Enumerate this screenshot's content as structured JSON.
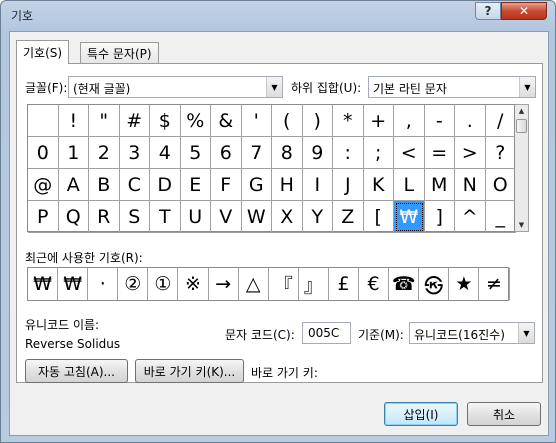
{
  "window": {
    "title": "기호",
    "help": "?",
    "close": "✕"
  },
  "tabs": [
    {
      "label": "기호(S)",
      "active": true
    },
    {
      "label": "특수 문자(P)",
      "active": false
    }
  ],
  "font": {
    "label": "글꼴(F):",
    "value": "(현재 글꼴)"
  },
  "subset": {
    "label": "하위 집합(U):",
    "value": "기본 라틴 문자"
  },
  "grid": {
    "rows": [
      [
        "",
        "!",
        "\"",
        "#",
        "$",
        "%",
        "&",
        "'",
        "(",
        ")",
        "*",
        "+",
        ",",
        "-",
        ".",
        "/"
      ],
      [
        "0",
        "1",
        "2",
        "3",
        "4",
        "5",
        "6",
        "7",
        "8",
        "9",
        ":",
        ";",
        "<",
        "=",
        ">",
        "?"
      ],
      [
        "@",
        "A",
        "B",
        "C",
        "D",
        "E",
        "F",
        "G",
        "H",
        "I",
        "J",
        "K",
        "L",
        "M",
        "N",
        "O"
      ],
      [
        "P",
        "Q",
        "R",
        "S",
        "T",
        "U",
        "V",
        "W",
        "X",
        "Y",
        "Z",
        "[",
        "₩",
        "]",
        "^",
        "_"
      ]
    ],
    "selected": "₩"
  },
  "recent": {
    "label": "최근에 사용한 기호(R):",
    "symbols": [
      "₩",
      "₩",
      "·",
      "②",
      "①",
      "※",
      "→",
      "△",
      "『",
      "』",
      "£",
      "€",
      "☎",
      "㉿",
      "★",
      "≠"
    ]
  },
  "unicode": {
    "label": "유니코드 이름:",
    "value": "Reverse Solidus"
  },
  "char_code": {
    "label": "문자 코드(C):",
    "value": "005C"
  },
  "basis": {
    "label": "기준(M):",
    "value": "유니코드(16진수)"
  },
  "buttons": {
    "autocorrect": "자동 고침(A)...",
    "shortcut_key": "바로 가기 키(K)...",
    "shortcut_label": "바로 가기 키:",
    "insert": "삽입(I)",
    "cancel": "취소"
  }
}
